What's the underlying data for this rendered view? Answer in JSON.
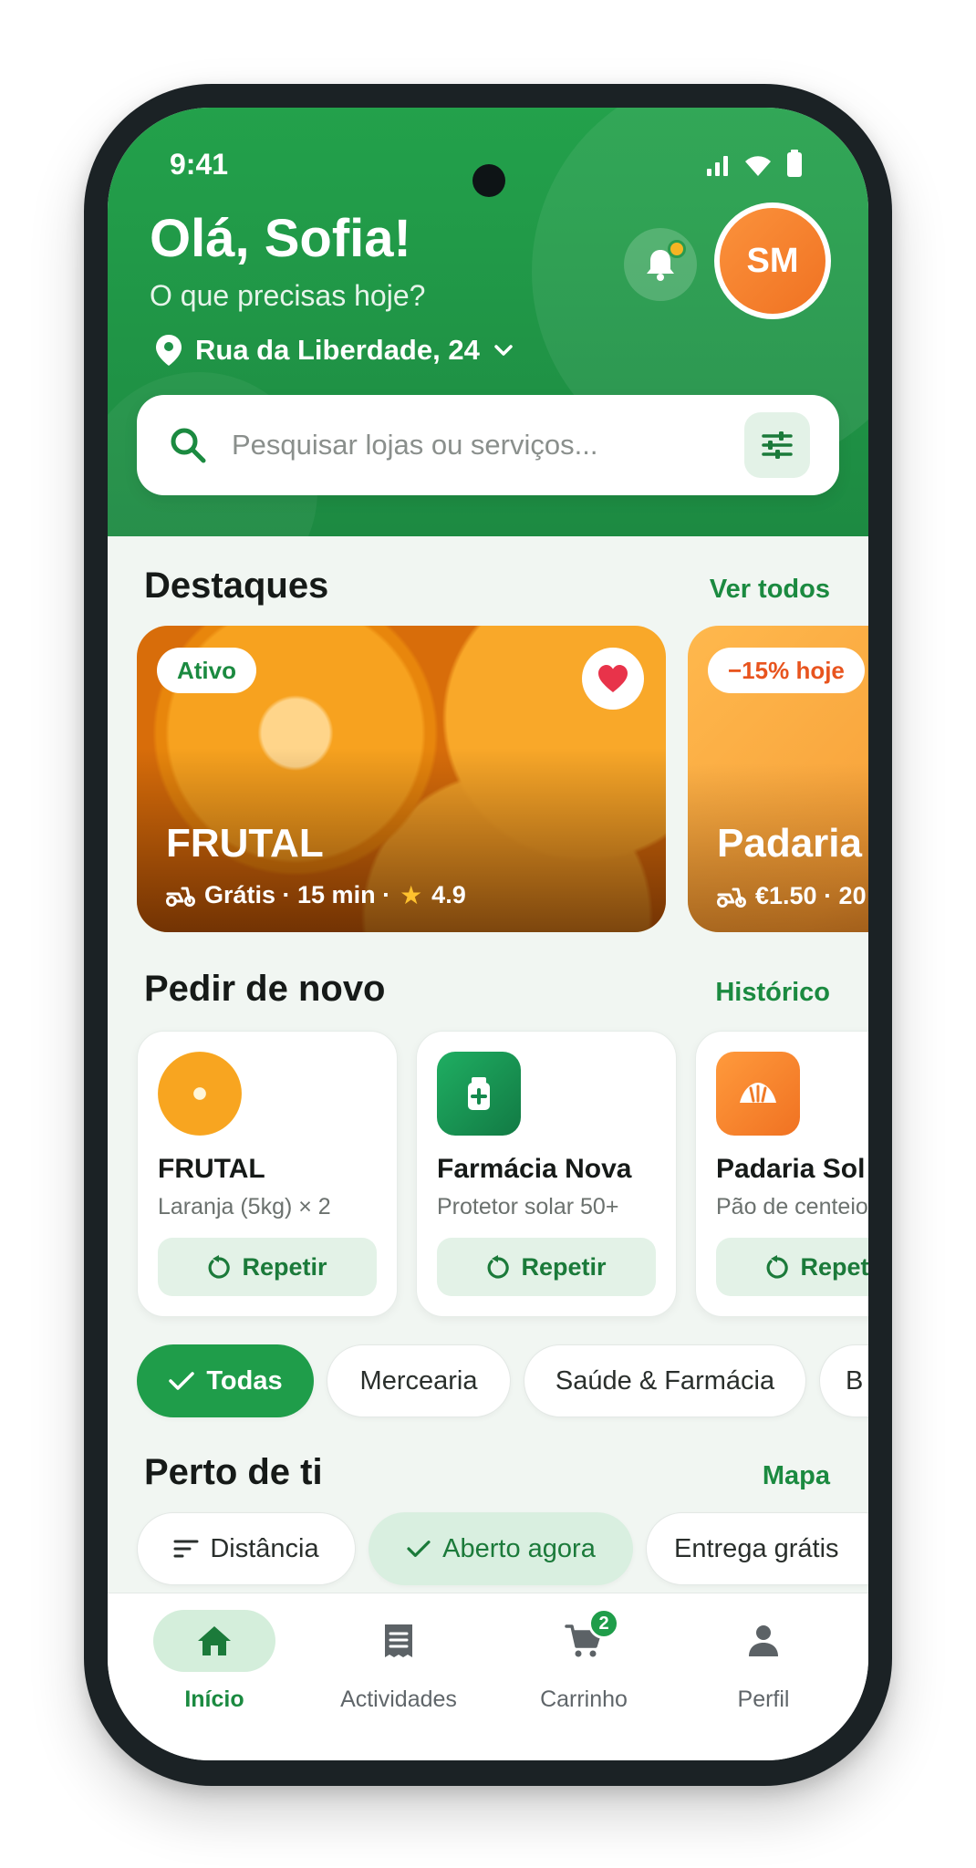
{
  "status": {
    "time": "9:41"
  },
  "header": {
    "greeting": "Olá, Sofia!",
    "subtitle": "O que precisas hoje?",
    "location": "Rua da Liberdade, 24",
    "avatar_initials": "SM",
    "notification_dot_color": "#f5b423"
  },
  "search": {
    "placeholder": "Pesquisar lojas ou serviços..."
  },
  "featured": {
    "title": "Destaques",
    "link": "Ver todos",
    "cards": [
      {
        "badge": "Ativo",
        "name": "FRUTAL",
        "delivery": "Grátis · 15 min ·",
        "rating": "4.9",
        "favorite": true
      },
      {
        "badge": "−15% hoje",
        "name": "Padaria",
        "delivery": "€1.50 · 20"
      }
    ]
  },
  "reorder": {
    "title": "Pedir de novo",
    "link": "Histórico",
    "button_label": "Repetir",
    "cards": [
      {
        "name": "FRUTAL",
        "desc": "Laranja (5kg) × 2",
        "icon": "orange-icon"
      },
      {
        "name": "Farmácia Nova",
        "desc": "Protetor solar 50+",
        "icon": "pharmacy-icon"
      },
      {
        "name": "Padaria Sol",
        "desc": "Pão de centeio",
        "icon": "bread-icon"
      }
    ]
  },
  "categories": [
    "Todas",
    "Mercearia",
    "Saúde & Farmácia",
    "B"
  ],
  "nearby": {
    "title": "Perto de ti",
    "link": "Mapa",
    "filters": [
      "Distância",
      "Aberto agora",
      "Entrega grátis"
    ]
  },
  "nav": {
    "items": [
      "Início",
      "Actividades",
      "Carrinho",
      "Perfil"
    ],
    "cart_count": "2",
    "active": "Início"
  },
  "colors": {
    "brand": "#1f9d4a",
    "accent_orange": "#f07222"
  }
}
